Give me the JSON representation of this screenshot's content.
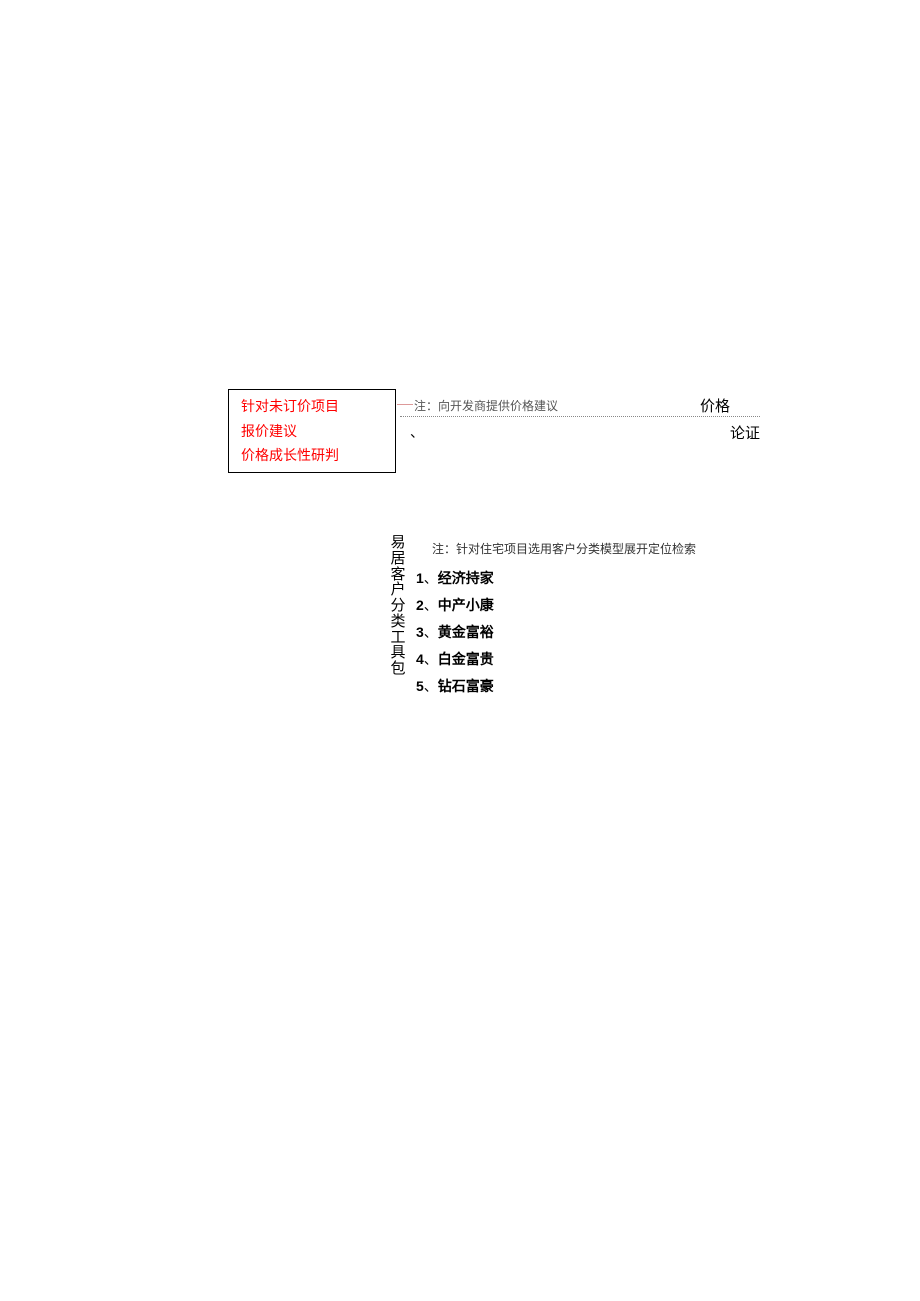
{
  "box": {
    "line1": "针对未订价项目",
    "line2": "报价建议",
    "line3": "价格成长性研判"
  },
  "note1": "注：向开发商提供价格建议",
  "priceLabel": "价格",
  "dotUnder": "、",
  "lunzheng": "论证",
  "vertTitle": "易居客户分类工具包",
  "note2": "注：针对住宅项目选用客户分类模型展开定位检索",
  "list": [
    {
      "num": "1",
      "sep": "、",
      "txt": "经济持家"
    },
    {
      "num": "2",
      "sep": "、",
      "txt": "中产小康"
    },
    {
      "num": "3",
      "sep": "、",
      "txt": "黄金富裕"
    },
    {
      "num": "4",
      "sep": "、",
      "txt": "白金富贵"
    },
    {
      "num": "5",
      "sep": "、",
      "txt": "钻石富豪"
    }
  ]
}
